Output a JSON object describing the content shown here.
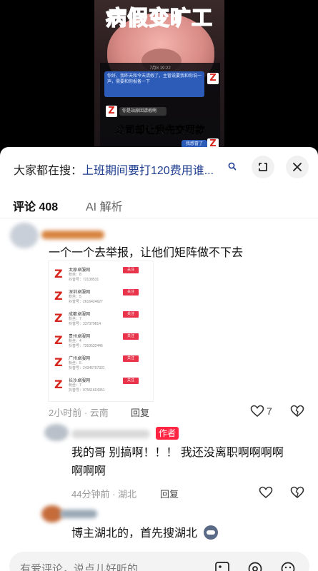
{
  "video": {
    "title": "病假变旷工",
    "chat_time": "7月8 19:22",
    "blue_message": "你好，我昨天和今天请假了，主管说要我和你说一声，需要和你报备一下",
    "grey_message": "你是站原因请假啊",
    "caption": "公司却让我先交罚款",
    "blue_reply": "我感冒了"
  },
  "search": {
    "prefix": "大家都在搜：",
    "query": "上班期间要打120费用谁...",
    "query_icon": "search-icon"
  },
  "tabs": [
    {
      "label": "评论 408",
      "active": true
    },
    {
      "label": "AI 解析",
      "active": false
    }
  ],
  "comments": [
    {
      "text": "一个一个去举报，让他们矩阵做不下去",
      "time_location": "2小时前 · 云南",
      "reply_label": "回复",
      "likes": "7",
      "screenshot_rows": [
        {
          "name": "太原卓服网",
          "sub1": "粉丝：8",
          "sub2": "抖音号：72138531",
          "tag": "关注"
        },
        {
          "name": "深圳卓服网",
          "sub1": "粉丝：5",
          "sub2": "抖音号：2616424627",
          "tag": "关注"
        },
        {
          "name": "成都卓服网",
          "sub1": "粉丝：7",
          "sub2": "抖音号：337379814",
          "tag": "关注"
        },
        {
          "name": "贵州卓服网",
          "sub1": "粉丝：4",
          "sub2": "抖音号：7263532446",
          "tag": "关注"
        },
        {
          "name": "广州卓服网",
          "sub1": "粉丝：5",
          "sub2": "抖音号：24345797331",
          "tag": "关注"
        },
        {
          "name": "长沙卓服网",
          "sub1": "粉丝：7",
          "sub2": "抖音号：97561664351",
          "tag": "关注"
        }
      ]
    },
    {
      "badge": "作者",
      "text_line1": "我的哥  别搞啊！！！  我还没离职啊啊啊啊",
      "text_line2": "啊啊啊",
      "time_location": "44分钟前 · 湖北",
      "reply_label": "回复"
    },
    {
      "text": "博主湖北的，首先搜湖北"
    }
  ],
  "input": {
    "placeholder": "有爱评论，说点儿好听的"
  }
}
